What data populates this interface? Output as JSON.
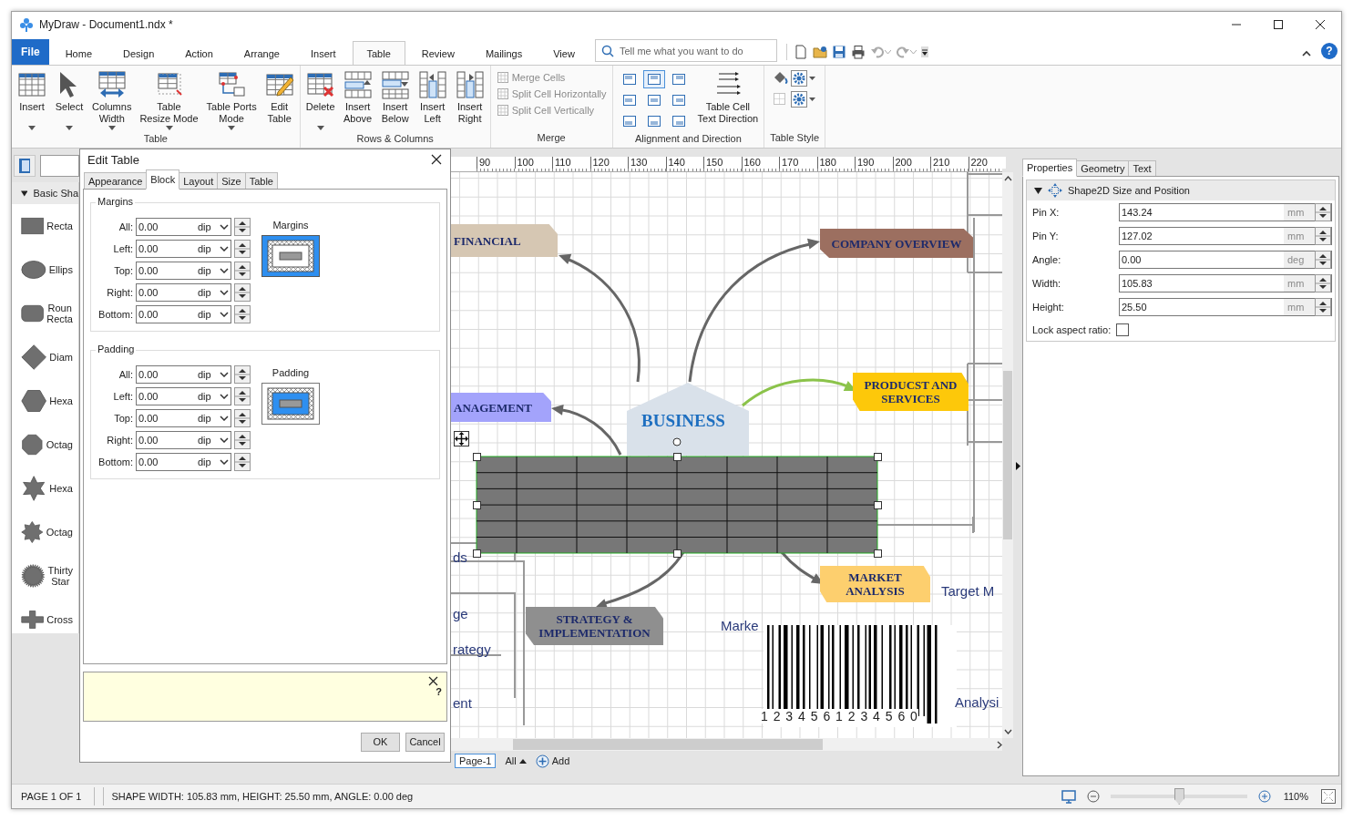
{
  "window": {
    "title": "MyDraw - Document1.ndx *"
  },
  "ribbon_tabs": [
    {
      "label": "File",
      "kind": "file",
      "selected": false
    },
    {
      "label": "Home",
      "kind": "tab",
      "selected": false
    },
    {
      "label": "Design",
      "kind": "tab",
      "selected": false
    },
    {
      "label": "Action",
      "kind": "tab",
      "selected": false
    },
    {
      "label": "Arrange",
      "kind": "tab",
      "selected": false
    },
    {
      "label": "Insert",
      "kind": "tab",
      "selected": false
    },
    {
      "label": "Table",
      "kind": "tab",
      "selected": true
    },
    {
      "label": "Review",
      "kind": "tab",
      "selected": false
    },
    {
      "label": "Mailings",
      "kind": "tab",
      "selected": false
    },
    {
      "label": "View",
      "kind": "tab",
      "selected": false
    }
  ],
  "search": {
    "placeholder": "Tell me what you want to do"
  },
  "help": "?",
  "ribbon_groups": [
    {
      "kind": "buttons",
      "label": "Table",
      "buttons": [
        {
          "label": "Insert",
          "dropdown": true
        },
        {
          "label": "Select",
          "dropdown": true
        },
        {
          "label": "Columns\nWidth",
          "dropdown": true
        },
        {
          "label": "Table\nResize Mode",
          "dropdown": true
        },
        {
          "label": "Table Ports\nMode",
          "dropdown": true
        },
        {
          "label": "Edit\nTable",
          "dropdown": false
        }
      ]
    },
    {
      "kind": "buttons",
      "label": "Rows & Columns",
      "buttons": [
        {
          "label": "Delete",
          "dropdown": true
        },
        {
          "label": "Insert\nAbove",
          "dropdown": false
        },
        {
          "label": "Insert\nBelow",
          "dropdown": false
        },
        {
          "label": "Insert\nLeft",
          "dropdown": false
        },
        {
          "label": "Insert\nRight",
          "dropdown": false
        }
      ]
    },
    {
      "kind": "list",
      "label": "Merge",
      "items": [
        {
          "label": "Merge Cells",
          "disabled": true
        },
        {
          "label": "Split Cell Horizontally",
          "disabled": true
        },
        {
          "label": "Split Cell Vertically",
          "disabled": true
        }
      ]
    },
    {
      "kind": "align",
      "label": "Alignment and Direction",
      "alignments": [
        {
          "selected": false
        },
        {
          "selected": true
        },
        {
          "selected": false
        },
        {
          "selected": false
        },
        {
          "selected": false
        },
        {
          "selected": false
        },
        {
          "selected": false
        },
        {
          "selected": false
        },
        {
          "selected": false
        }
      ],
      "buttons": [
        {
          "label": "Table Cell\nText Direction",
          "dropdown": false
        }
      ]
    },
    {
      "kind": "style",
      "label": "Table Style"
    }
  ],
  "shapes_panel": {
    "title": "Basic Sha",
    "items": [
      {
        "label": "Recta",
        "kind": "rect"
      },
      {
        "label": "Ellips",
        "kind": "ellipse"
      },
      {
        "label": "Roun\nRecta",
        "kind": "roundrect"
      },
      {
        "label": "Diam",
        "kind": "diamond"
      },
      {
        "label": "Hexa",
        "kind": "hexagon"
      },
      {
        "label": "Octag",
        "kind": "octagon"
      },
      {
        "label": "Hexa",
        "kind": "star6"
      },
      {
        "label": "Octag",
        "kind": "star8"
      },
      {
        "label": "Thirty\nStar",
        "kind": "star30"
      },
      {
        "label": "Cross",
        "kind": "cross"
      }
    ]
  },
  "dialog": {
    "title": "Edit Table",
    "tabs": [
      {
        "label": "Appearance",
        "selected": false
      },
      {
        "label": "Block",
        "selected": true
      },
      {
        "label": "Layout",
        "selected": false
      },
      {
        "label": "Size",
        "selected": false
      },
      {
        "label": "Table",
        "selected": false
      }
    ],
    "groups": [
      {
        "label": "Margins",
        "preview": {
          "label": "Margins",
          "kind": "margins"
        },
        "fields": [
          {
            "label": "All:",
            "value": "0.00",
            "unit": "dip"
          },
          {
            "label": "Left:",
            "value": "0.00",
            "unit": "dip"
          },
          {
            "label": "Top:",
            "value": "0.00",
            "unit": "dip"
          },
          {
            "label": "Right:",
            "value": "0.00",
            "unit": "dip"
          },
          {
            "label": "Bottom:",
            "value": "0.00",
            "unit": "dip"
          }
        ]
      },
      {
        "label": "Padding",
        "preview": {
          "label": "Padding",
          "kind": "padding"
        },
        "fields": [
          {
            "label": "All:",
            "value": "0.00",
            "unit": "dip"
          },
          {
            "label": "Left:",
            "value": "0.00",
            "unit": "dip"
          },
          {
            "label": "Top:",
            "value": "0.00",
            "unit": "dip"
          },
          {
            "label": "Right:",
            "value": "0.00",
            "unit": "dip"
          },
          {
            "label": "Bottom:",
            "value": "0.00",
            "unit": "dip"
          }
        ]
      }
    ],
    "hint_help": "?",
    "buttons": [
      "OK",
      "Cancel"
    ]
  },
  "canvas": {
    "ruler": [
      "90",
      "100",
      "110",
      "120",
      "130",
      "140",
      "150",
      "160",
      "170",
      "180",
      "190",
      "200",
      "210",
      "220"
    ],
    "nodes": [
      {
        "text": "FINANCIAL",
        "color": "#d6c7b3"
      },
      {
        "text": "COMPANY OVERVIEW",
        "color": "#9c6f60"
      },
      {
        "text": "ANAGEMENT",
        "color": "#a3a3fb"
      },
      {
        "text": "PRODUCST AND SERVICES",
        "color": "#fdc80a"
      },
      {
        "text": "MARKET ANALYSIS",
        "color": "#fdcf6e"
      },
      {
        "text": "STRATEGY & IMPLEMENTATION",
        "color": "#8f8f8f"
      }
    ],
    "center": {
      "text": "BUSINESS"
    },
    "labels": [
      "ds",
      "ge",
      "rategy",
      "ent",
      "Target M",
      "Marke",
      "Analysi"
    ],
    "barcode": {
      "digits": "1 2 3 4 5 6 1 2 3 4 5 6 0"
    }
  },
  "page_bar": {
    "tabs": [
      {
        "label": "Page-1",
        "selected": true
      }
    ],
    "all": "All",
    "add": "Add"
  },
  "properties": {
    "tabs": [
      {
        "label": "Properties",
        "selected": true
      },
      {
        "label": "Geometry",
        "selected": false
      },
      {
        "label": "Text",
        "selected": false
      }
    ],
    "section": {
      "title": "Shape2D Size and Position",
      "expanded": true
    },
    "rows": [
      {
        "label": "Pin X:",
        "value": "143.24",
        "unit": "mm"
      },
      {
        "label": "Pin Y:",
        "value": "127.02",
        "unit": "mm"
      },
      {
        "label": "Angle:",
        "value": "0.00",
        "unit": "deg"
      },
      {
        "label": "Width:",
        "value": "105.83",
        "unit": "mm"
      },
      {
        "label": "Height:",
        "value": "25.50",
        "unit": "mm"
      }
    ],
    "lock": {
      "label": "Lock aspect ratio:",
      "checked": false
    }
  },
  "status_bar": {
    "page": "PAGE 1 OF 1",
    "shape": "SHAPE WIDTH: 105.83 mm, HEIGHT: 25.50 mm, ANGLE: 0.00 deg",
    "zoom": {
      "level": 0.5,
      "reading": "110%"
    }
  }
}
